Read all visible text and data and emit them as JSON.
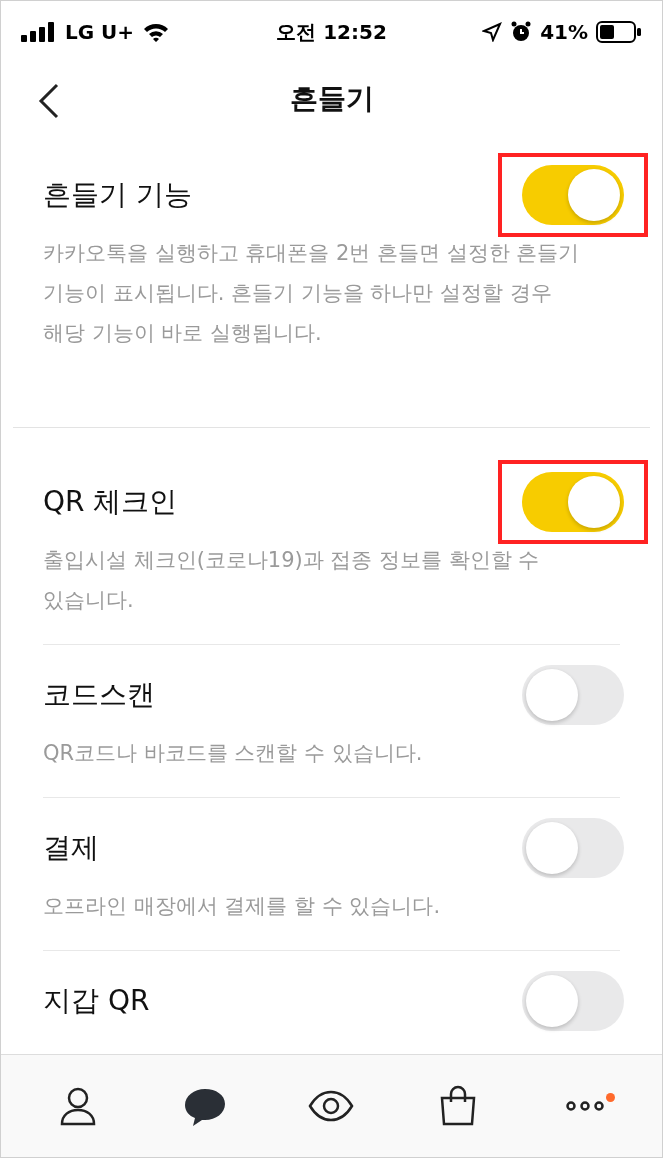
{
  "status_bar": {
    "carrier": "LG U+",
    "time": "오전 12:52",
    "battery": "41%"
  },
  "header": {
    "title": "흔들기"
  },
  "sections": [
    {
      "items": [
        {
          "title": "흔들기 기능",
          "description": "카카오톡을 실행하고 휴대폰을 2번 흔들면 설정한 흔들기 기능이 표시됩니다. 흔들기 기능을 하나만 설정할 경우 해당 기능이 바로 실행됩니다.",
          "on": true,
          "highlighted": true
        }
      ]
    },
    {
      "items": [
        {
          "title": "QR 체크인",
          "description": "출입시설 체크인(코로나19)과 접종 정보를 확인할 수 있습니다.",
          "on": true,
          "highlighted": true
        },
        {
          "title": "코드스캔",
          "description": "QR코드나 바코드를 스캔할 수 있습니다.",
          "on": false,
          "highlighted": false
        },
        {
          "title": "결제",
          "description": "오프라인 매장에서 결제를 할 수 있습니다.",
          "on": false,
          "highlighted": false
        },
        {
          "title": "지갑 QR",
          "on": false,
          "highlighted": false
        }
      ]
    }
  ],
  "tab_bar": [
    {
      "kind": "friends",
      "badge": false
    },
    {
      "kind": "chats",
      "badge": false
    },
    {
      "kind": "view",
      "badge": false
    },
    {
      "kind": "shopping",
      "badge": false
    },
    {
      "kind": "more",
      "badge": true
    }
  ]
}
